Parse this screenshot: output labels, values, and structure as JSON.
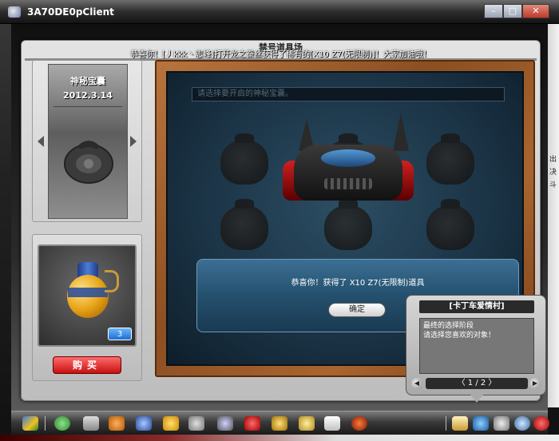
{
  "window": {
    "title": "3A70DE0pClient",
    "min_glyph": "–",
    "max_glyph": "□",
    "close_glyph": "✕"
  },
  "dialog": {
    "title": "禁号道具场",
    "broadcast": "恭喜你！[丿kkk丶志峰]打开龙之蚕丝获得了稀有的[X10 Z7(无限制)]！大家加油哦！"
  },
  "mystery_box": {
    "name": "神秘宝囊",
    "date": "2012.3.14",
    "prev_glyph": "◀",
    "next_glyph": "▶"
  },
  "item": {
    "count": "3",
    "buy_label": "购买"
  },
  "board": {
    "prompt": "请选择要开启的神秘宝囊。"
  },
  "congrats": {
    "message": "恭喜你！获得了 X10 Z7(无限制)道具",
    "ok_label": "确定"
  },
  "npc": {
    "title": "[卡丁车爱情村]",
    "line1": "最终的选择阶段",
    "line2": "请选择您喜欢的对象！",
    "page": "〈 1 / 2 〉",
    "prev_glyph": "◀",
    "next_glyph": "▶"
  },
  "right_strip": {
    "a": "出",
    "b": "决",
    "c": "斗"
  },
  "colors": {
    "accent_red": "#c81010",
    "board_blue": "#1a3244",
    "wood": "#8b4f22"
  },
  "taskbar_icons": [
    "start-icon",
    "back-icon",
    "cart-icon",
    "character-icon",
    "kart-icon",
    "pet-icon",
    "gear-parts-icon",
    "camera-icon",
    "heart-icon",
    "key-icon",
    "wrench-icon",
    "book-icon",
    "ball-icon",
    "mail-icon",
    "balloon-icon",
    "tools-icon",
    "search-icon",
    "power-icon"
  ]
}
